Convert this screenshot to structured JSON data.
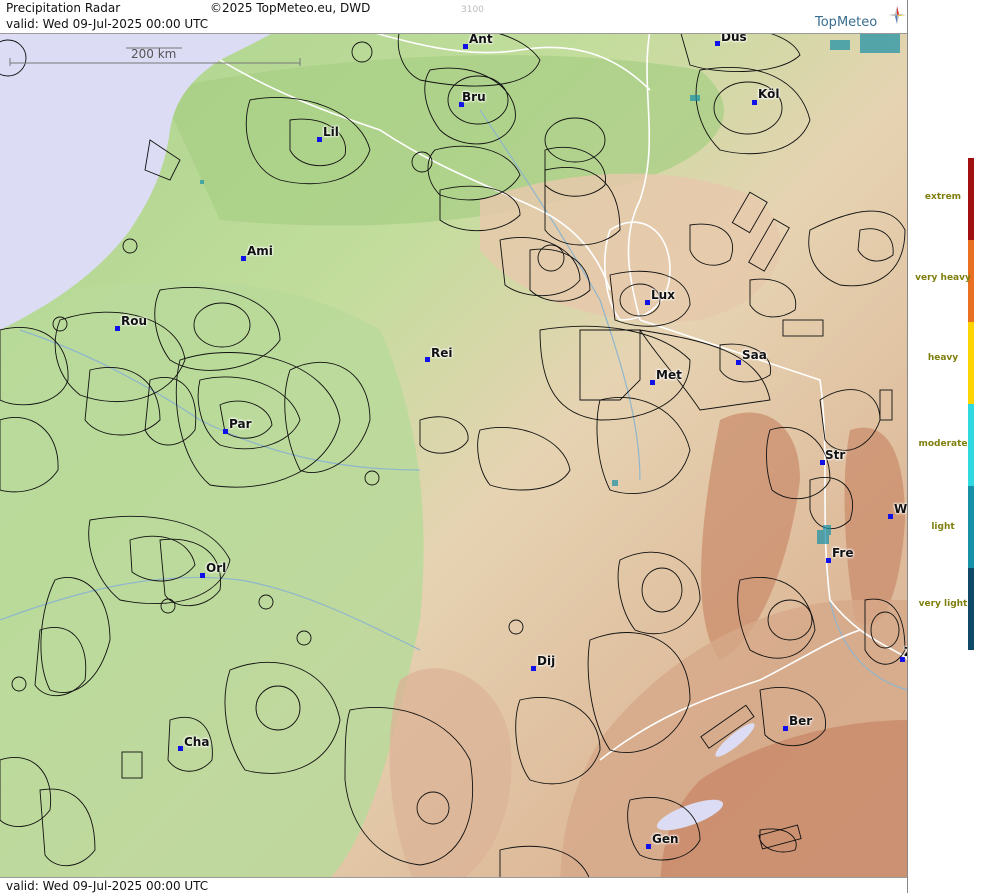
{
  "header": {
    "title": "Precipitation Radar",
    "copyright": "©2025 TopMeteo.eu, DWD",
    "code": "3100",
    "valid_top": "valid:  Wed  09-Jul-2025 00:00 UTC",
    "valid_bottom": "valid:  Wed  09-Jul-2025 00:00 UTC",
    "logo": "TopMeteo"
  },
  "scale": {
    "label": "200 km"
  },
  "cities": {
    "ant": "Ant",
    "dus": "Düs",
    "bru": "Bru",
    "kol": "Köl",
    "lil": "Lil",
    "ami": "Ami",
    "rou": "Rou",
    "lux": "Lux",
    "rei": "Rei",
    "saa": "Saa",
    "met": "Met",
    "par": "Par",
    "str": "Str",
    "w": "W",
    "fre": "Fre",
    "orl": "Orl",
    "dij": "Dij",
    "ber": "Ber",
    "cha": "Cha",
    "gen": "Gen",
    "z": "Z"
  },
  "legend": {
    "levels": [
      "extrem",
      "very heavy",
      "heavy",
      "moderate",
      "light",
      "very light"
    ],
    "colors": {
      "extrem": "#a01010",
      "very_heavy": "#e87020",
      "heavy": "#ffd400",
      "moderate": "#30d8e0",
      "light": "#1890a8",
      "very_light": "#0e4a68"
    }
  },
  "colors": {
    "sea": "#dcdcf5",
    "lowland": "#b8d99a",
    "highland": "#e8cdb4",
    "mountain": "#c98a6a",
    "borders": "#ffffff",
    "zones": "#111111"
  }
}
